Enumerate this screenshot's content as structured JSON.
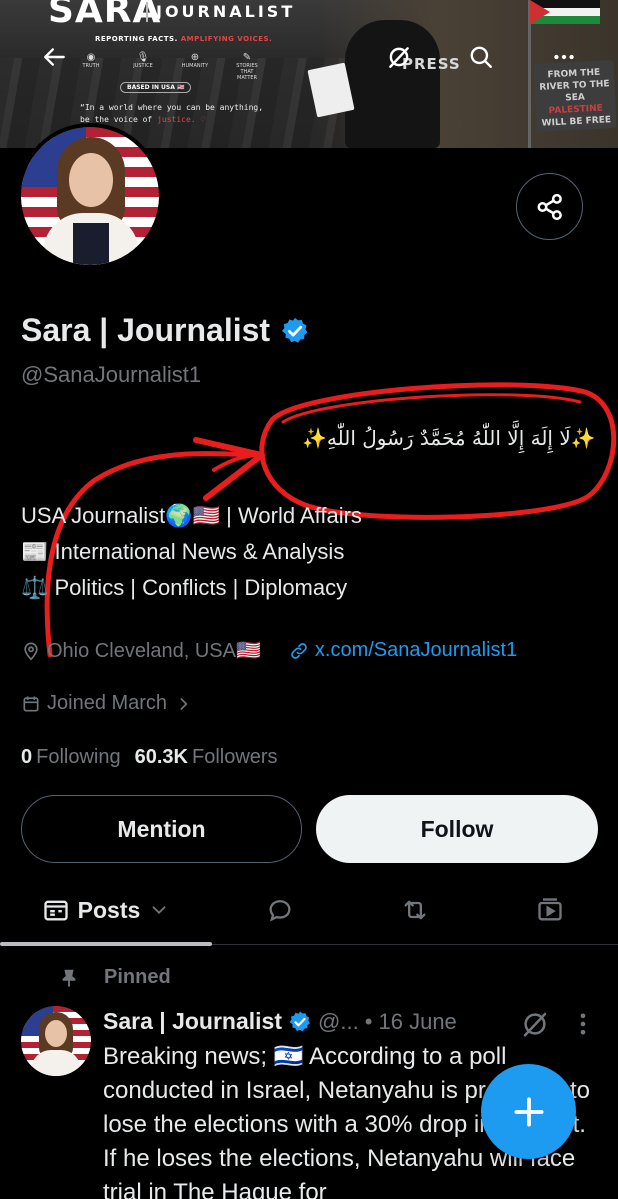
{
  "banner": {
    "brand": "SARA",
    "brand_sub": "JOURNALIST",
    "tagline_white": "REPORTING FACTS.",
    "tagline_red": "AMPLIFYING VOICES.",
    "icon_labels": [
      "TRUTH",
      "JUSTICE",
      "HUMANITY",
      "STORIES THAT MATTER"
    ],
    "based": "BASED IN USA 🇺🇸",
    "quote_line1": "“In a world where you can be anything,",
    "quote_line2": "be the voice of",
    "quote_red": "justice.",
    "press": "PRESS",
    "sign_line1": "FROM THE",
    "sign_line2": "RIVER TO THE SEA",
    "sign_line3": "PALESTINE",
    "sign_line4": "WILL BE FREE"
  },
  "profile": {
    "name": "Sara | Journalist",
    "handle": "@SanaJournalist1",
    "arabic_line": "✨لَا إِلَهَ إِلَّا اللّٰهُ مُحَمَّدٌ رَسُولُ اللّٰهِ✨",
    "bio_lines": [
      "USA Journalist🌍🇺🇸 | World Affairs",
      "📰 International News &  Analysis",
      "⚖️ Politics | Conflicts | Diplomacy"
    ],
    "location": "Ohio Cleveland, USA🇺🇸",
    "website": "x.com/SanaJournalist1",
    "joined": "Joined March",
    "following_count": "0",
    "following_label": "Following",
    "followers_count": "60.3K",
    "followers_label": "Followers"
  },
  "actions": {
    "mention": "Mention",
    "follow": "Follow"
  },
  "tabs": {
    "posts": "Posts"
  },
  "post": {
    "pinned_label": "Pinned",
    "author": "Sara | Journalist",
    "handle": "@...",
    "date": "• 16 June",
    "body": "Breaking news; 🇮🇱 According to a poll conducted in Israel, Netanyahu is predicted to lose the elections with a 30% drop in support. If he loses the elections, Netanyahu will face trial in The Hague for"
  },
  "colors": {
    "background": "#000000",
    "text": "#e7e9ea",
    "muted": "#71767b",
    "accent": "#1d9bf0",
    "annotation": "#e81d1d"
  }
}
